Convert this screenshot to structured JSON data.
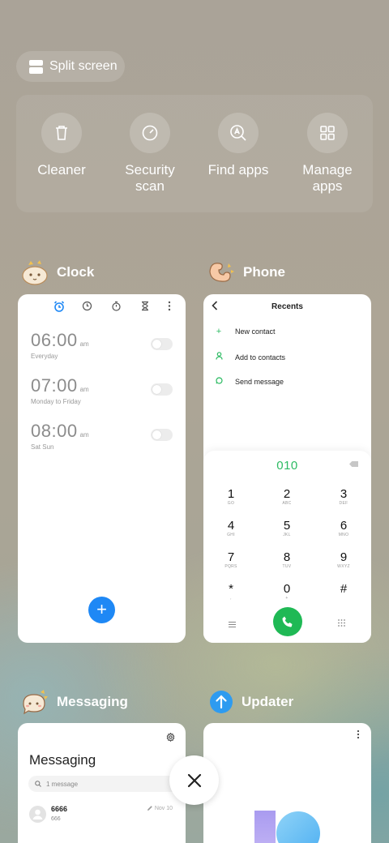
{
  "split_screen": {
    "label": "Split screen"
  },
  "tools": [
    {
      "label": "Cleaner",
      "icon": "trash-icon"
    },
    {
      "label": "Security\nscan",
      "icon": "security-scan-icon"
    },
    {
      "label": "Find apps",
      "icon": "find-apps-icon"
    },
    {
      "label": "Manage\napps",
      "icon": "grid-icon"
    }
  ],
  "apps": {
    "clock": {
      "name": "Clock",
      "alarms": [
        {
          "time": "06:00",
          "ampm": "am",
          "repeat": "Everyday",
          "enabled": false
        },
        {
          "time": "07:00",
          "ampm": "am",
          "repeat": "Monday to Friday",
          "enabled": false
        },
        {
          "time": "08:00",
          "ampm": "am",
          "repeat": "Sat Sun",
          "enabled": false
        }
      ],
      "accent": "#1e88f5"
    },
    "phone": {
      "name": "Phone",
      "title": "Recents",
      "actions": [
        {
          "label": "New contact",
          "icon": "plus-icon"
        },
        {
          "label": "Add to contacts",
          "icon": "person-icon"
        },
        {
          "label": "Send message",
          "icon": "message-icon"
        }
      ],
      "dialed_number": "010",
      "keys": [
        {
          "digit": "1",
          "letters": "GO"
        },
        {
          "digit": "2",
          "letters": "ABC"
        },
        {
          "digit": "3",
          "letters": "DEF"
        },
        {
          "digit": "4",
          "letters": "GHI"
        },
        {
          "digit": "5",
          "letters": "JKL"
        },
        {
          "digit": "6",
          "letters": "MNO"
        },
        {
          "digit": "7",
          "letters": "PQRS"
        },
        {
          "digit": "8",
          "letters": "TUV"
        },
        {
          "digit": "9",
          "letters": "WXYZ"
        },
        {
          "digit": "*",
          "letters": ","
        },
        {
          "digit": "0",
          "letters": "+"
        },
        {
          "digit": "#",
          "letters": ""
        }
      ],
      "accent": "#2dbb63"
    },
    "messaging": {
      "name": "Messaging",
      "title": "Messaging",
      "search_placeholder": "1 message",
      "threads": [
        {
          "name": "6666",
          "preview": "666",
          "date": "Nov 10"
        }
      ]
    },
    "updater": {
      "name": "Updater"
    }
  }
}
